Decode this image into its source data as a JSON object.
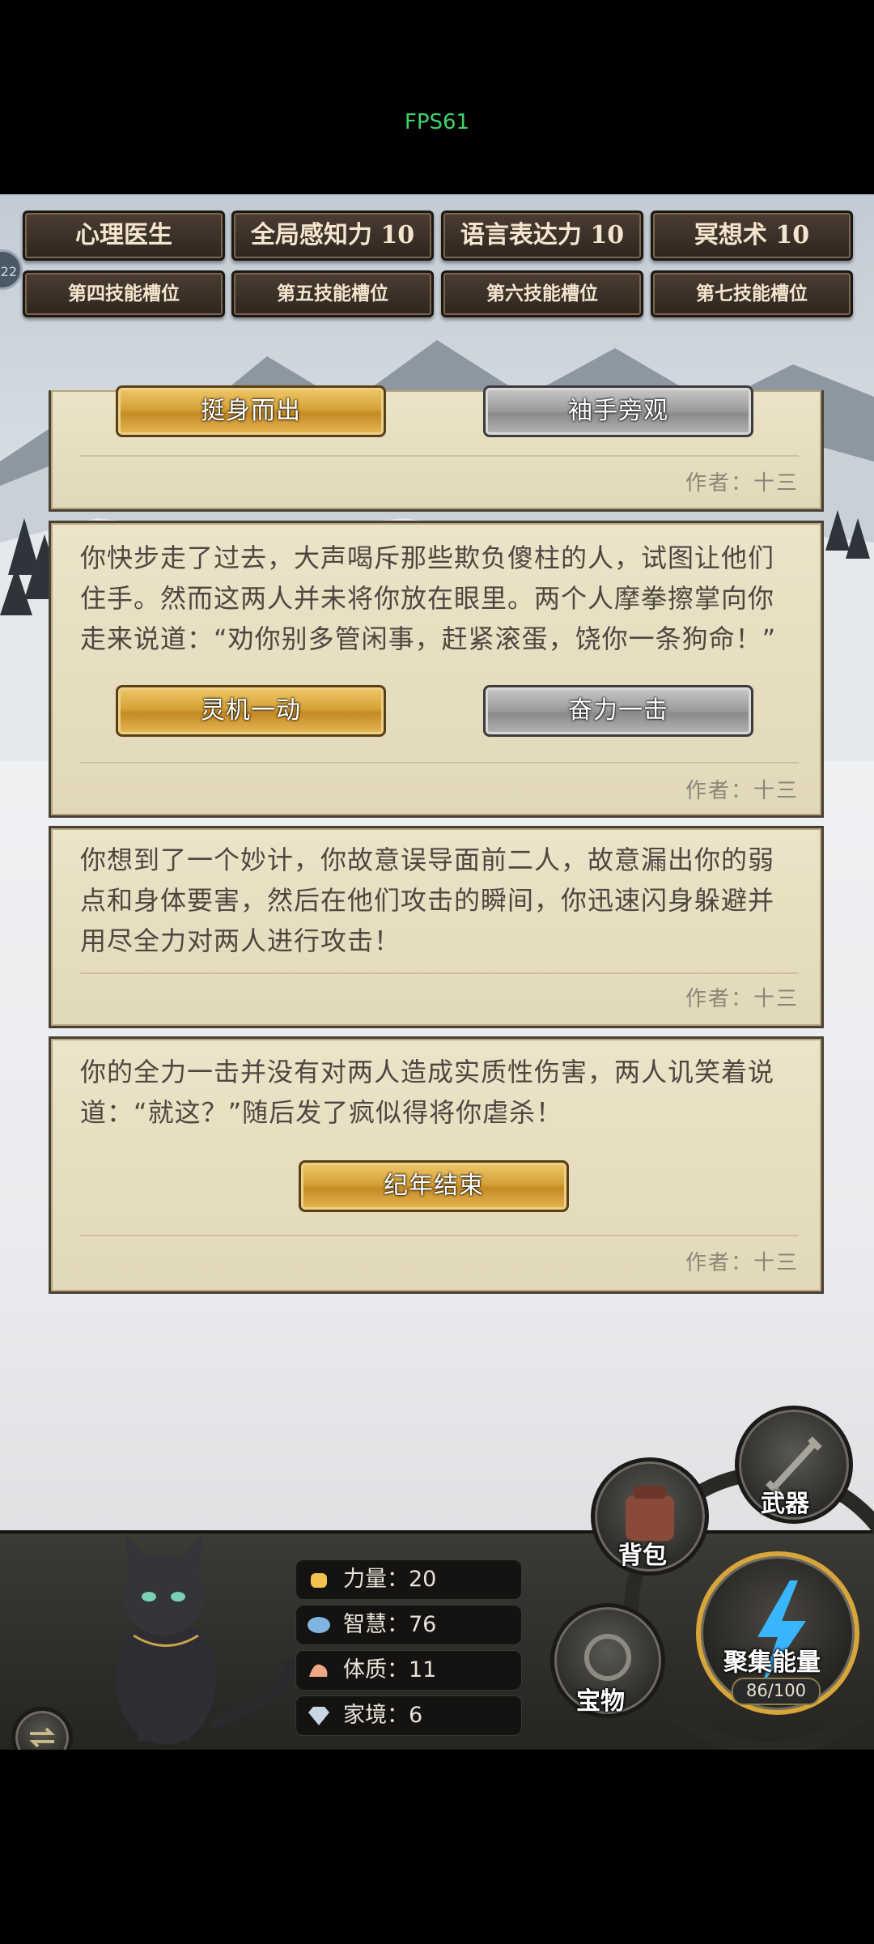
{
  "status": {
    "fps": "FPS61"
  },
  "skills": {
    "row1": [
      "心理医生",
      "全局感知力 10",
      "语言表达力 10",
      "冥想术 10"
    ],
    "row2": [
      "第四技能槽位",
      "第五技能槽位",
      "第六技能槽位",
      "第七技能槽位"
    ],
    "side_badge": "22"
  },
  "cards": [
    {
      "buttons": [
        "挺身而出",
        "袖手旁观"
      ],
      "author": "作者：十三"
    },
    {
      "text": "你快步走了过去，大声喝斥那些欺负傻柱的人，试图让他们住手。然而这两人并未将你放在眼里。两个人摩拳擦掌向你走来说道：“劝你别多管闲事，赶紧滚蛋，饶你一条狗命！”",
      "buttons": [
        "灵机一动",
        "奋力一击"
      ],
      "author": "作者：十三"
    },
    {
      "text": "你想到了一个妙计，你故意误导面前二人，故意漏出你的弱点和身体要害，然后在他们攻击的瞬间，你迅速闪身躲避并用尽全力对两人进行攻击！",
      "author": "作者：十三"
    },
    {
      "text": "你的全力一击并没有对两人造成实质性伤害，两人讥笑着说道：“就这？”随后发了疯似得将你虐杀！",
      "buttons": [
        "纪年结束"
      ],
      "author": "作者：十三"
    }
  ],
  "stats": [
    {
      "label": "力量：20",
      "icon": "fist-icon"
    },
    {
      "label": "智慧：76",
      "icon": "brain-icon"
    },
    {
      "label": "体质：11",
      "icon": "muscle-icon"
    },
    {
      "label": "家境：6",
      "icon": "diamond-icon"
    }
  ],
  "actions": {
    "weapon": "武器",
    "backpack": "背包",
    "treasure": "宝物",
    "gather_energy": "聚集能量",
    "energy_count": "86/100"
  },
  "colors": {
    "gold_button": "#d6a238",
    "grey_button": "#9a9a9a",
    "card_bg": "#e9dfbf",
    "fps_text": "#3fd46a"
  }
}
